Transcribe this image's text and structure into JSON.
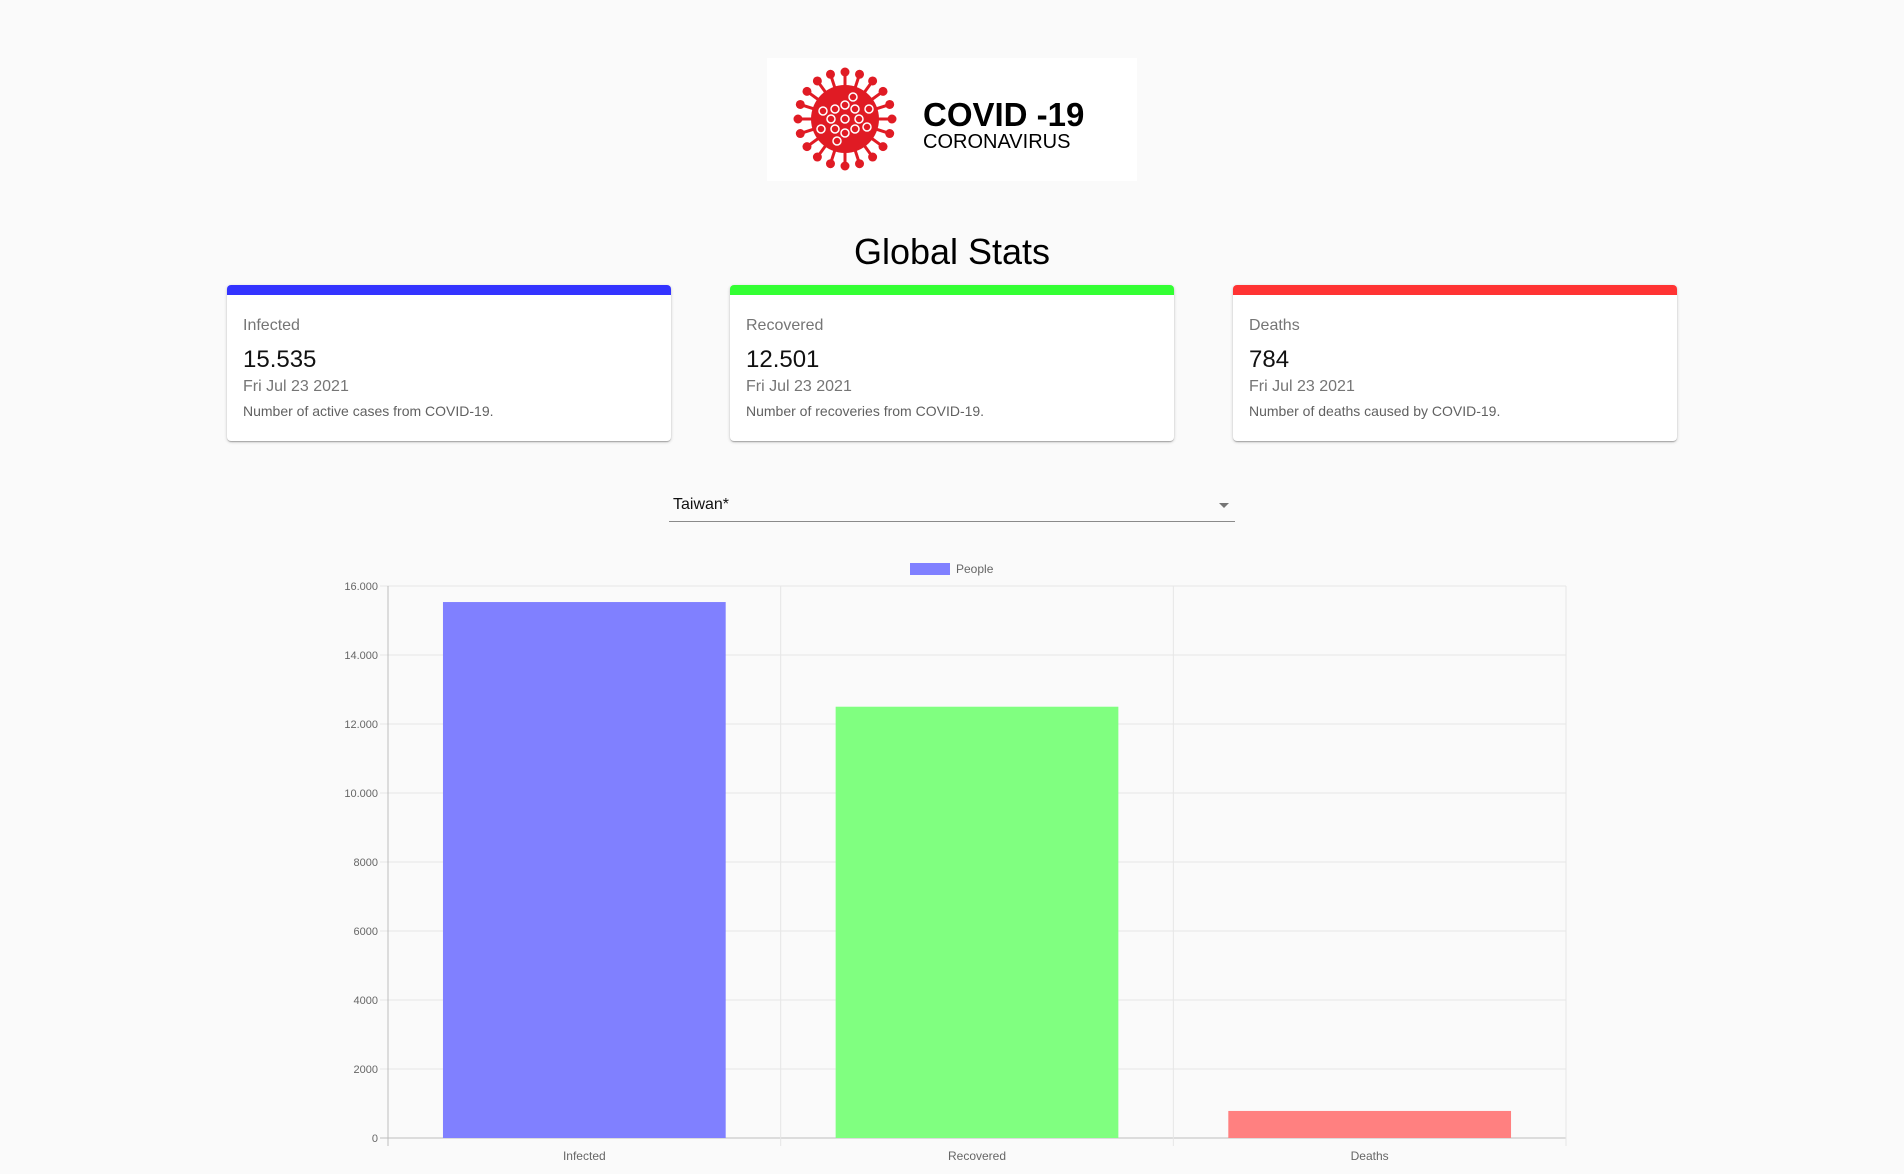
{
  "header": {
    "logo_title": "COVID -19",
    "logo_subtitle": "CORONAVIRUS",
    "page_title": "Global Stats"
  },
  "cards": [
    {
      "label": "Infected",
      "value": "15.535",
      "date": "Fri Jul 23 2021",
      "description": "Number of active cases from COVID-19.",
      "color": "#3333ff"
    },
    {
      "label": "Recovered",
      "value": "12.501",
      "date": "Fri Jul 23 2021",
      "description": "Number of recoveries from COVID-19.",
      "color": "#33ff33"
    },
    {
      "label": "Deaths",
      "value": "784",
      "date": "Fri Jul 23 2021",
      "description": "Number of deaths caused by COVID-19.",
      "color": "#ff3333"
    }
  ],
  "country_select": {
    "value": "Taiwan*",
    "icon": "arrow-drop-down-icon"
  },
  "colors": {
    "logo_red": "#e01b24"
  },
  "chart_data": {
    "type": "bar",
    "categories": [
      "Infected",
      "Recovered",
      "Deaths"
    ],
    "series": [
      {
        "name": "People",
        "values": [
          15535,
          12501,
          784
        ]
      }
    ],
    "bar_colors": [
      "#8080ff",
      "#80ff80",
      "#ff8080"
    ],
    "legend_color": "#8080ff",
    "legend_position": "top",
    "ylim": [
      0,
      16000
    ],
    "yticks": [
      0,
      2000,
      4000,
      6000,
      8000,
      10000,
      12000,
      14000,
      16000
    ],
    "ytick_labels": [
      "0",
      "2000",
      "4000",
      "6000",
      "8000",
      "10.000",
      "12.000",
      "14.000",
      "16.000"
    ],
    "grid": true
  }
}
